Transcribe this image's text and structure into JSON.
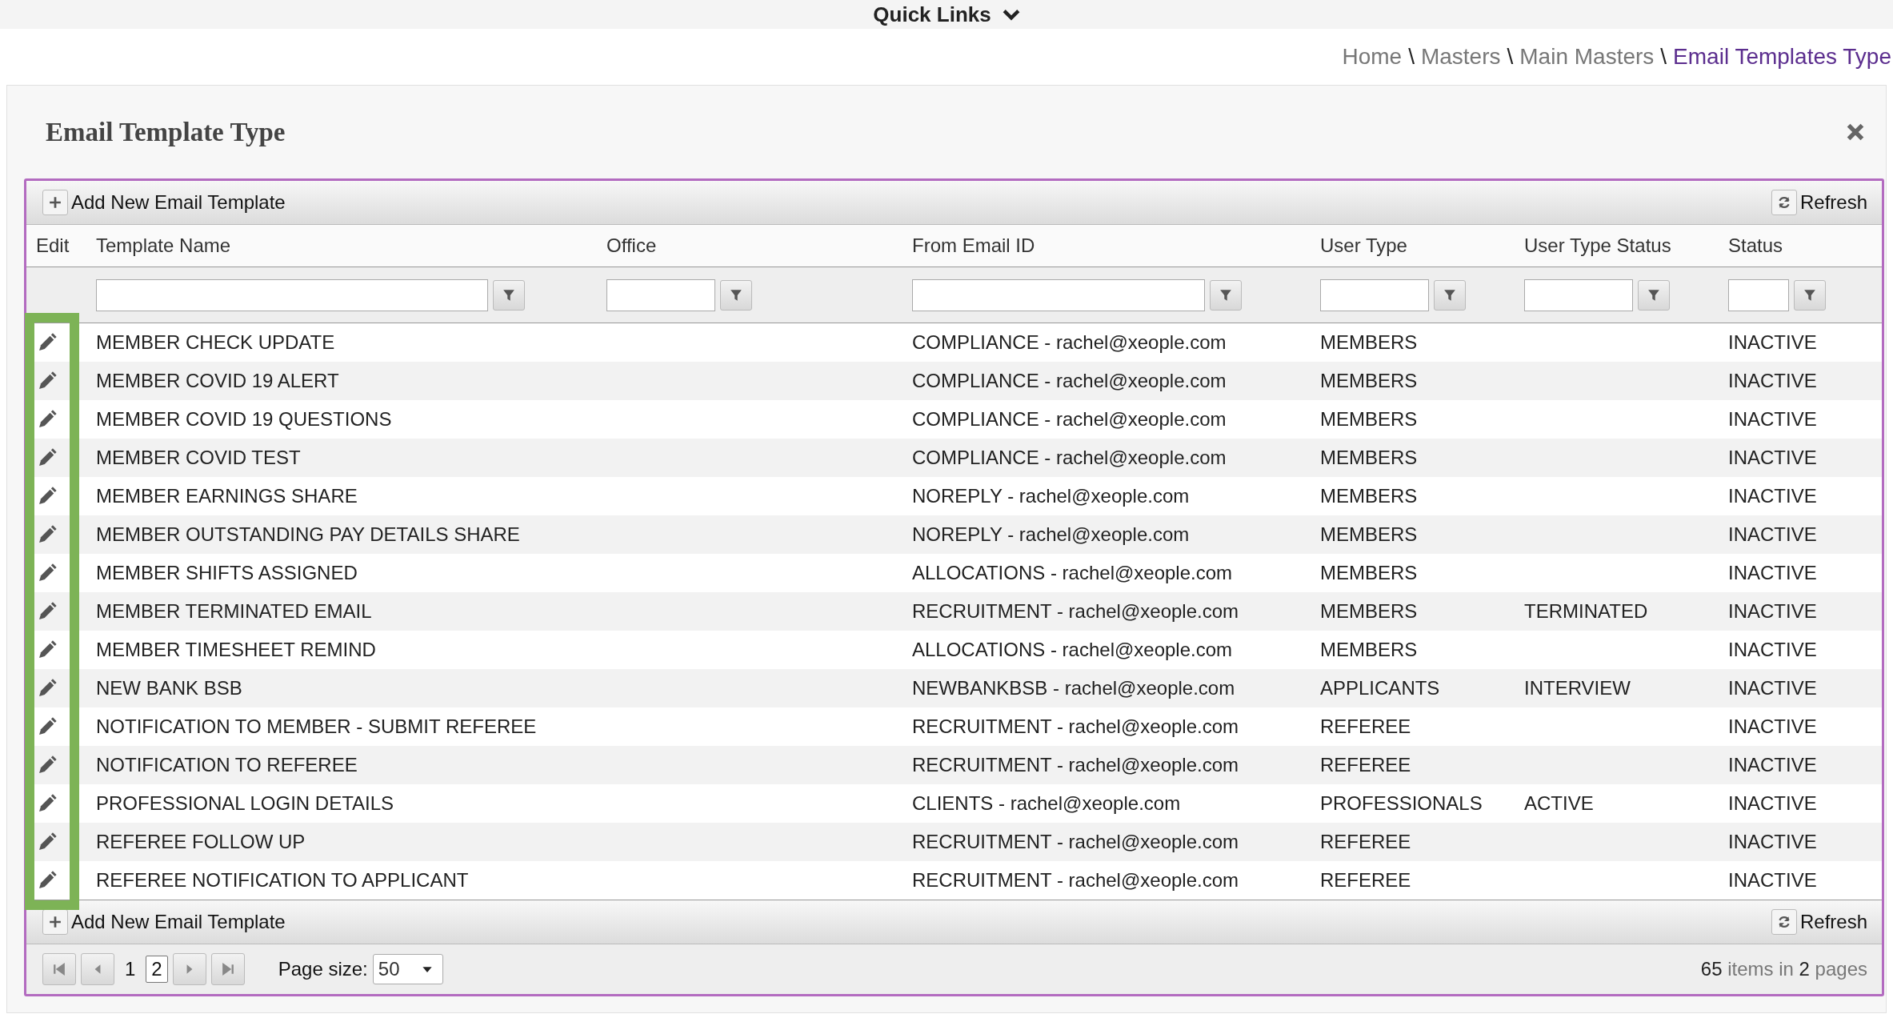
{
  "quick_links": {
    "label": "Quick Links"
  },
  "breadcrumb": {
    "separator": "\\",
    "items": [
      {
        "label": "Home",
        "current": false
      },
      {
        "label": "Masters",
        "current": false
      },
      {
        "label": "Main Masters",
        "current": false
      },
      {
        "label": "Email Templates Type",
        "current": true
      }
    ]
  },
  "panel": {
    "title": "Email Template Type"
  },
  "toolbar": {
    "add_label": "Add New Email Template",
    "refresh_label": "Refresh"
  },
  "table": {
    "columns": [
      "Edit",
      "Template Name",
      "Office",
      "From Email ID",
      "User Type",
      "User Type Status",
      "Status"
    ],
    "edit_column_highlighted": true,
    "rows": [
      {
        "name": "MEMBER CHECK UPDATE",
        "from": "COMPLIANCE - rachel@xeople.com",
        "user_type": "MEMBERS",
        "status": "INACTIVE"
      },
      {
        "name": "MEMBER COVID 19 ALERT",
        "from": "COMPLIANCE - rachel@xeople.com",
        "user_type": "MEMBERS",
        "status": "INACTIVE"
      },
      {
        "name": "MEMBER COVID 19 QUESTIONS",
        "from": "COMPLIANCE - rachel@xeople.com",
        "user_type": "MEMBERS",
        "status": "INACTIVE"
      },
      {
        "name": "MEMBER COVID TEST",
        "from": "COMPLIANCE - rachel@xeople.com",
        "user_type": "MEMBERS",
        "status": "INACTIVE"
      },
      {
        "name": "MEMBER EARNINGS SHARE",
        "from": "NOREPLY - rachel@xeople.com",
        "user_type": "MEMBERS",
        "status": "INACTIVE"
      },
      {
        "name": "MEMBER OUTSTANDING PAY DETAILS SHARE",
        "from": "NOREPLY - rachel@xeople.com",
        "user_type": "MEMBERS",
        "status": "INACTIVE"
      },
      {
        "name": "MEMBER SHIFTS ASSIGNED",
        "from": "ALLOCATIONS - rachel@xeople.com",
        "user_type": "MEMBERS",
        "status": "INACTIVE"
      },
      {
        "name": "MEMBER TERMINATED EMAIL",
        "from": "RECRUITMENT - rachel@xeople.com",
        "user_type": "MEMBERS",
        "user_type_status": "TERMINATED",
        "status": "INACTIVE"
      },
      {
        "name": "MEMBER TIMESHEET REMIND",
        "from": "ALLOCATIONS - rachel@xeople.com",
        "user_type": "MEMBERS",
        "status": "INACTIVE"
      },
      {
        "name": "NEW BANK BSB",
        "from": "NEWBANKBSB - rachel@xeople.com",
        "user_type": "APPLICANTS",
        "user_type_status": "INTERVIEW",
        "status": "INACTIVE"
      },
      {
        "name": "NOTIFICATION TO MEMBER - SUBMIT REFEREE",
        "from": "RECRUITMENT - rachel@xeople.com",
        "user_type": "REFEREE",
        "status": "INACTIVE"
      },
      {
        "name": "NOTIFICATION TO REFEREE",
        "from": "RECRUITMENT - rachel@xeople.com",
        "user_type": "REFEREE",
        "status": "INACTIVE"
      },
      {
        "name": "PROFESSIONAL LOGIN DETAILS",
        "from": "CLIENTS - rachel@xeople.com",
        "user_type": "PROFESSIONALS",
        "user_type_status": "ACTIVE",
        "status": "INACTIVE"
      },
      {
        "name": "REFEREE FOLLOW UP",
        "from": "RECRUITMENT - rachel@xeople.com",
        "user_type": "REFEREE",
        "status": "INACTIVE"
      },
      {
        "name": "REFEREE NOTIFICATION TO APPLICANT",
        "from": "RECRUITMENT - rachel@xeople.com",
        "user_type": "REFEREE",
        "status": "INACTIVE"
      }
    ]
  },
  "bottom_toolbar": {
    "add_label": "Add New Email Template",
    "refresh_label": "Refresh"
  },
  "pager": {
    "pages": [
      {
        "label": "1",
        "selected": false
      },
      {
        "label": "2",
        "selected": true
      }
    ],
    "page_size_label": "Page size:",
    "page_size": "50",
    "summary": "**65** items in **2** pages"
  }
}
